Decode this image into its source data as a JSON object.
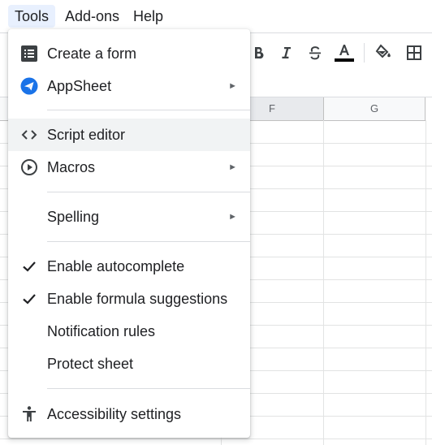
{
  "menubar": {
    "items": [
      {
        "label": "Tools",
        "active": true
      },
      {
        "label": "Add-ons",
        "active": false
      },
      {
        "label": "Help",
        "active": false
      }
    ]
  },
  "toolbar": {
    "icons": [
      "bold-icon",
      "italic-icon",
      "strikethrough-icon",
      "text-color-icon",
      "fill-color-icon",
      "borders-icon"
    ],
    "text_color": "#000000"
  },
  "grid": {
    "columns": [
      "F",
      "G"
    ]
  },
  "tools_menu": {
    "items": [
      {
        "label": "Create a form",
        "icon": "form-icon",
        "submenu": false
      },
      {
        "label": "AppSheet",
        "icon": "appsheet-icon",
        "submenu": true
      },
      {
        "label": "Script editor",
        "icon": "code-icon",
        "submenu": false,
        "hovered": true
      },
      {
        "label": "Macros",
        "icon": "play-circle-icon",
        "submenu": true
      },
      {
        "label": "Spelling",
        "icon": "",
        "submenu": true
      },
      {
        "label": "Enable autocomplete",
        "icon": "check-icon",
        "submenu": false,
        "checked": true
      },
      {
        "label": "Enable formula suggestions",
        "icon": "check-icon",
        "submenu": false,
        "checked": true
      },
      {
        "label": "Notification rules",
        "icon": "",
        "submenu": false
      },
      {
        "label": "Protect sheet",
        "icon": "",
        "submenu": false
      },
      {
        "label": "Accessibility settings",
        "icon": "accessibility-icon",
        "submenu": false
      }
    ],
    "submenu_arrow": "►"
  },
  "colors": {
    "accent": "#1a73e8",
    "active_menu_bg": "#e8f0fe",
    "hover_bg": "#f1f3f4"
  }
}
